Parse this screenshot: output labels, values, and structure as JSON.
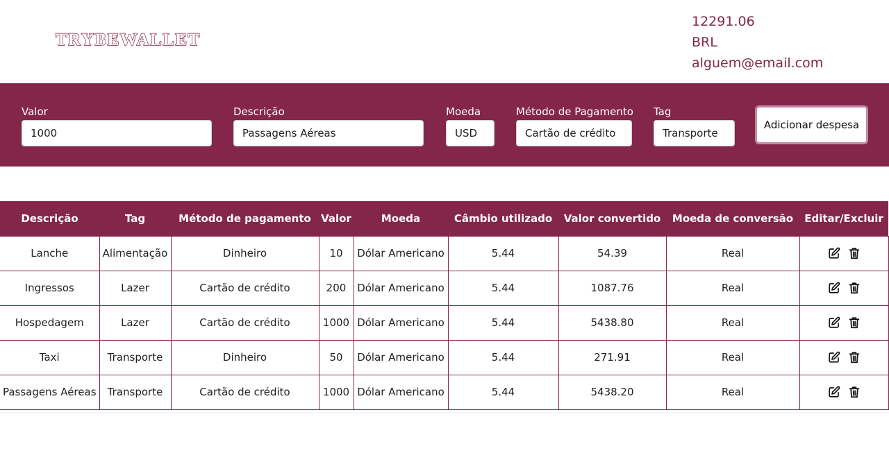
{
  "header": {
    "logo": "TRYBEWALLET",
    "total": "12291.06",
    "currency": "BRL",
    "email": "alguem@email.com"
  },
  "form": {
    "valor": {
      "label": "Valor",
      "value": "1000"
    },
    "descricao": {
      "label": "Descrição",
      "value": "Passagens Aéreas"
    },
    "moeda": {
      "label": "Moeda",
      "value": "USD"
    },
    "metodo": {
      "label": "Método de Pagamento",
      "value": "Cartão de crédito"
    },
    "tag": {
      "label": "Tag",
      "value": "Transporte"
    },
    "add_label": "Adicionar despesa"
  },
  "table": {
    "headers": [
      "Descrição",
      "Tag",
      "Método de pagamento",
      "Valor",
      "Moeda",
      "Câmbio utilizado",
      "Valor convertido",
      "Moeda de conversão",
      "Editar/Excluir"
    ],
    "rows": [
      [
        "Lanche",
        "Alimentação",
        "Dinheiro",
        "10",
        "Dólar Americano",
        "5.44",
        "54.39",
        "Real"
      ],
      [
        "Ingressos",
        "Lazer",
        "Cartão de crédito",
        "200",
        "Dólar Americano",
        "5.44",
        "1087.76",
        "Real"
      ],
      [
        "Hospedagem",
        "Lazer",
        "Cartão de crédito",
        "1000",
        "Dólar Americano",
        "5.44",
        "5438.80",
        "Real"
      ],
      [
        "Taxi",
        "Transporte",
        "Dinheiro",
        "50",
        "Dólar Americano",
        "5.44",
        "271.91",
        "Real"
      ],
      [
        "Passagens Aéreas",
        "Transporte",
        "Cartão de crédito",
        "1000",
        "Dólar Americano",
        "5.44",
        "5438.20",
        "Real"
      ]
    ]
  },
  "icons": {
    "edit": "edit-icon",
    "delete": "trash-icon"
  },
  "colors": {
    "brand": "#84264a",
    "button_border": "#c48ba2"
  }
}
